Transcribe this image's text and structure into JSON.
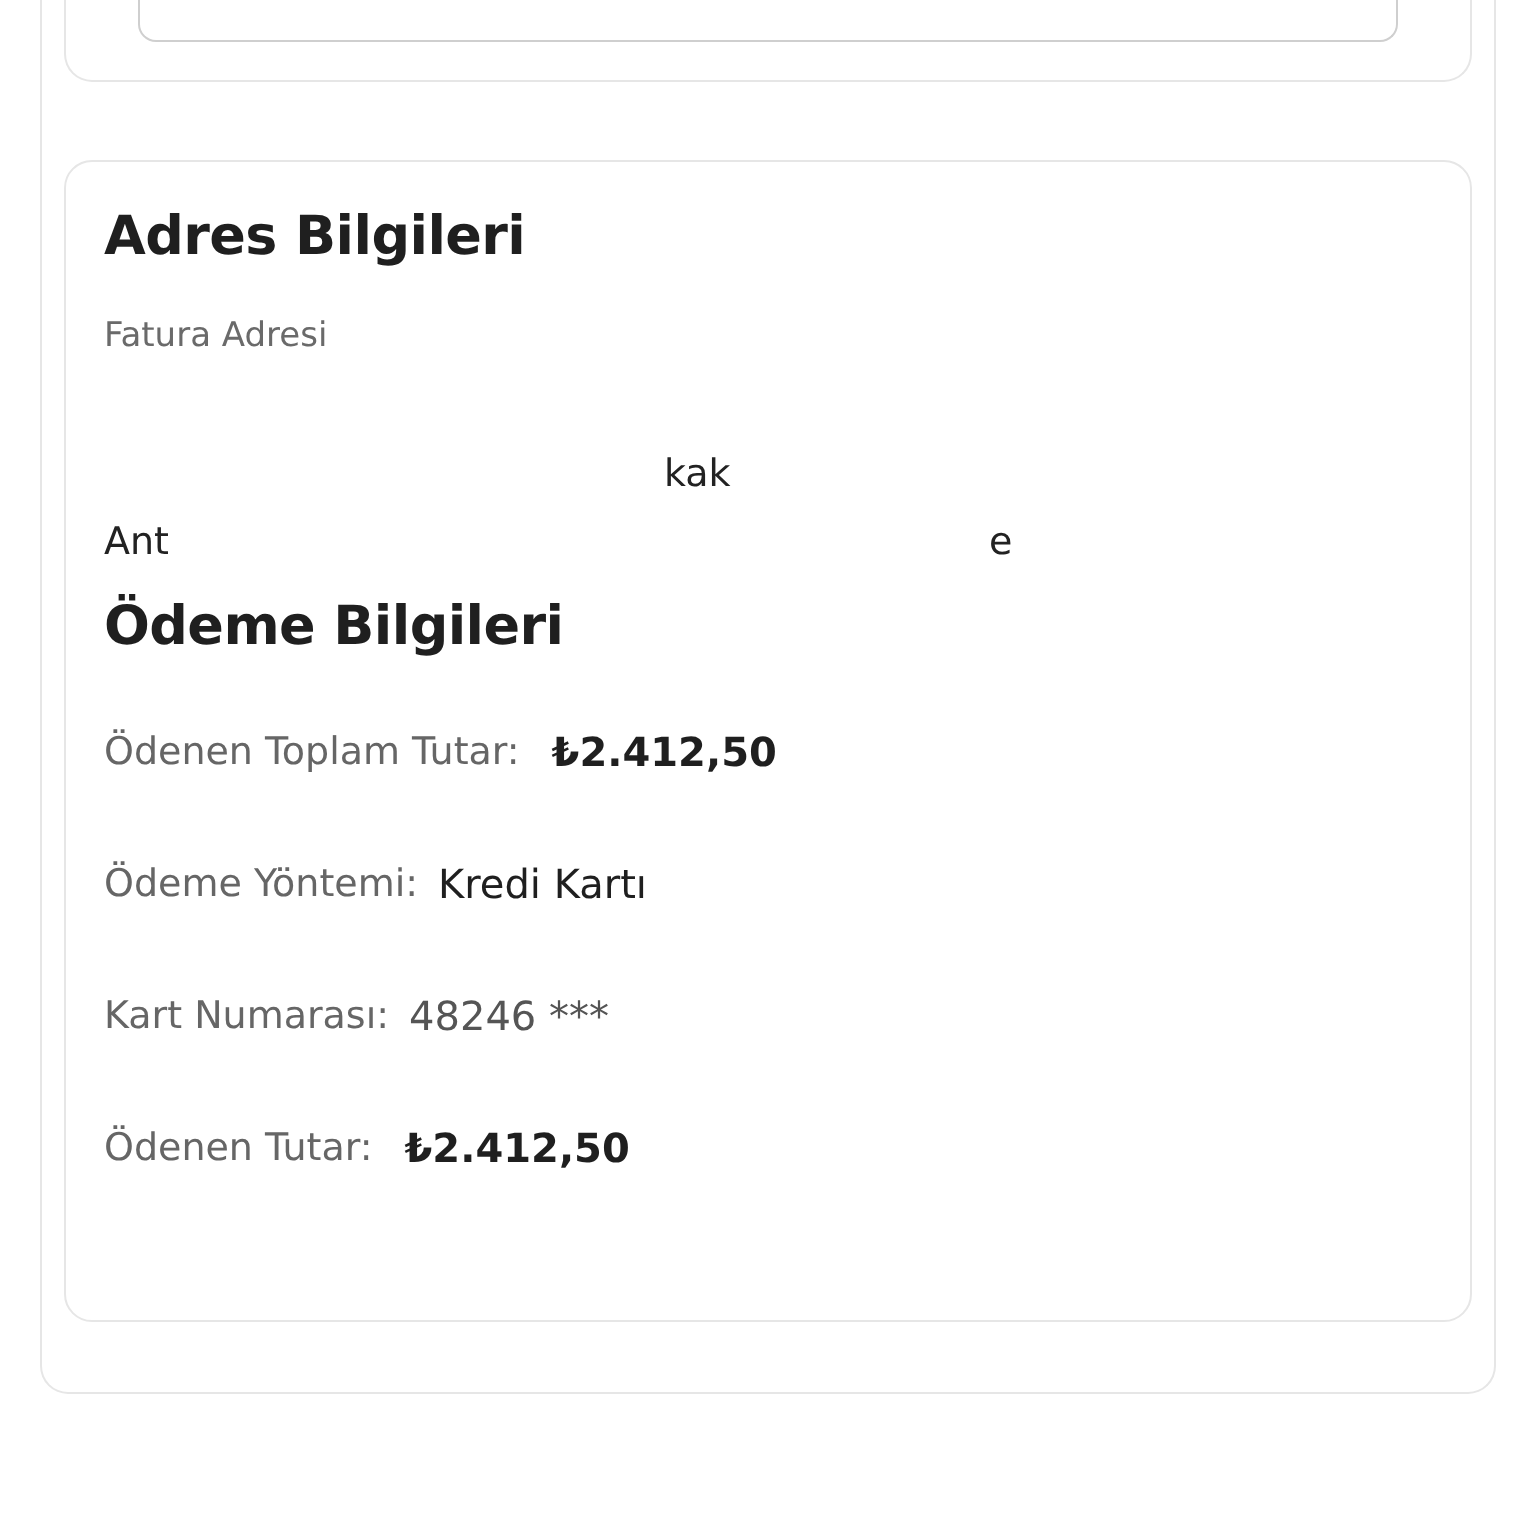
{
  "address_section": {
    "title": "Adres Bilgileri",
    "billing_label": "Fatura Adresi",
    "address_lines": [
      {
        "fragments": [
          "kak"
        ]
      },
      {
        "fragments": [
          "Ant",
          "e"
        ]
      }
    ]
  },
  "payment_section": {
    "title": "Ödeme Bilgileri",
    "rows": [
      {
        "label": "Ödenen Toplam Tutar:",
        "value": "₺2.412,50",
        "kind": "amount"
      },
      {
        "label": "Ödeme Yöntemi:",
        "value": "Kredi Kartı",
        "kind": "text"
      },
      {
        "label": "Kart Numarası:",
        "value": "48246 ***",
        "kind": "masked"
      },
      {
        "label": "Ödenen Tutar:",
        "value": "₺2.412,50",
        "kind": "amount"
      }
    ]
  }
}
